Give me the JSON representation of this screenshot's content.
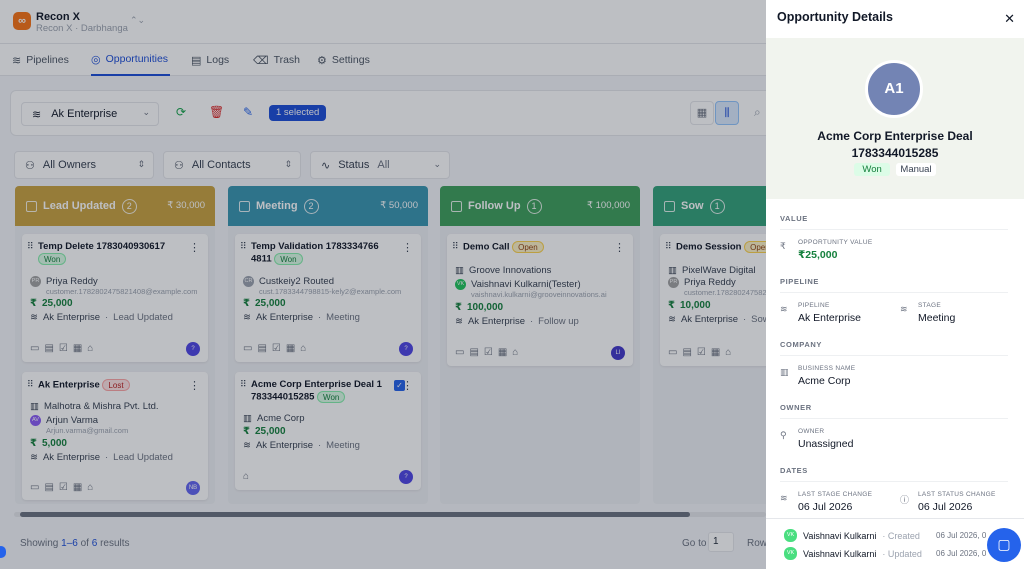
{
  "app": {
    "name": "Recon X",
    "workspace": "Recon X · Darbhanga"
  },
  "nav": [
    {
      "label": "Pipelines",
      "icon": "≋"
    },
    {
      "label": "Opportunities",
      "icon": "◎"
    },
    {
      "label": "Logs",
      "icon": "▤"
    },
    {
      "label": "Trash",
      "icon": "⌫"
    },
    {
      "label": "Settings",
      "icon": "⚙"
    }
  ],
  "toolbar": {
    "workspace": "Ak Enterprise",
    "selected": "1 selected"
  },
  "filters": {
    "owners": "All Owners",
    "contacts": "All Contacts",
    "status_label": "Status",
    "status_value": "All"
  },
  "columns": [
    {
      "name": "Lead Updated",
      "count": "2",
      "amount": "₹ 30,000",
      "color": "#c9a341"
    },
    {
      "name": "Meeting",
      "count": "2",
      "amount": "₹ 50,000",
      "color": "#3a96b0"
    },
    {
      "name": "Follow Up",
      "count": "1",
      "amount": "₹ 100,000",
      "color": "#3fa05c"
    },
    {
      "name": "Sow",
      "count": "1",
      "amount": "",
      "color": "#34a27a"
    }
  ],
  "cards": {
    "c1": {
      "title": "Temp Delete 1783040930617",
      "status": "Won",
      "contact": "Priya Reddy",
      "contact_initials": "PR",
      "email": "customer.1782802475821408@example.com",
      "amount": "25,000",
      "pipeline": "Ak Enterprise",
      "stage": "Lead Updated",
      "owner": "?"
    },
    "c2": {
      "title": "Ak Enterprise",
      "status": "Lost",
      "company": "Malhotra & Mishra Pvt. Ltd.",
      "contact": "Arjun Varma",
      "contact_initials": "AV",
      "email": "Arjun.varma@gmail.com",
      "amount": "5,000",
      "pipeline": "Ak Enterprise",
      "stage": "Lead Updated",
      "owner": "NB"
    },
    "c3": {
      "title": "Temp Validation 1783334766 4811",
      "status": "Won",
      "contact": "Custkeiy2 Routed",
      "contact_initials": "CR",
      "email": "cust.1783344798815-kely2@example.com",
      "amount": "25,000",
      "pipeline": "Ak Enterprise",
      "stage": "Meeting",
      "owner": "?"
    },
    "c4": {
      "title": "Acme Corp Enterprise Deal 1 783344015285",
      "status": "Won",
      "company": "Acme Corp",
      "amount": "25,000",
      "pipeline": "Ak Enterprise",
      "stage": "Meeting",
      "owner": "?"
    },
    "c5": {
      "title": "Demo Call",
      "status": "Open",
      "company": "Groove Innovations",
      "contact": "Vaishnavi Kulkarni(Tester)",
      "contact_initials": "VK",
      "email": "vaishnavi.kulkarni@grooveinnovations.ai",
      "amount": "100,000",
      "pipeline": "Ak Enterprise",
      "stage": "Follow up",
      "owner": "LI"
    },
    "c6": {
      "title": "Demo Session",
      "status": "Open",
      "company": "PixelWave Digital",
      "contact": "Priya Reddy",
      "contact_initials": "PR",
      "email": "customer.1782802475821408@example.com",
      "amount": "10,000",
      "pipeline": "Ak Enterprise",
      "stage": "Sow"
    }
  },
  "footer": {
    "prefix": "Showing",
    "range": "1–6",
    "of": "of",
    "total": "6",
    "suffix": "results",
    "goto": "Go to",
    "page": "1",
    "rows": "Rows"
  },
  "panel": {
    "title": "Opportunity Details",
    "avatar": "A1",
    "name_line1": "Acme Corp Enterprise Deal",
    "name_line2": "1783344015285",
    "status": "Won",
    "source": "Manual",
    "sections": {
      "value": "VALUE",
      "pipeline": "PIPELINE",
      "company": "COMPANY",
      "owner": "OWNER",
      "dates": "DATES"
    },
    "fields": {
      "opp_value_label": "OPPORTUNITY VALUE",
      "opp_value": "₹25,000",
      "pipeline_label": "PIPELINE",
      "pipeline": "Ak Enterprise",
      "stage_label": "STAGE",
      "stage": "Meeting",
      "business_label": "BUSINESS NAME",
      "business": "Acme Corp",
      "owner_label": "OWNER",
      "owner": "Unassigned",
      "last_stage_label": "LAST STAGE CHANGE",
      "last_stage": "06 Jul 2026",
      "last_status_label": "LAST STATUS CHANGE",
      "last_status": "06 Jul 2026"
    },
    "activity": [
      {
        "initials": "VK",
        "name": "Vaishnavi Kulkarni",
        "action": "· Created",
        "date": "06 Jul 2026, 0"
      },
      {
        "initials": "VK",
        "name": "Vaishnavi Kulkarni",
        "action": "· Updated",
        "date": "06 Jul 2026, 0"
      }
    ]
  }
}
